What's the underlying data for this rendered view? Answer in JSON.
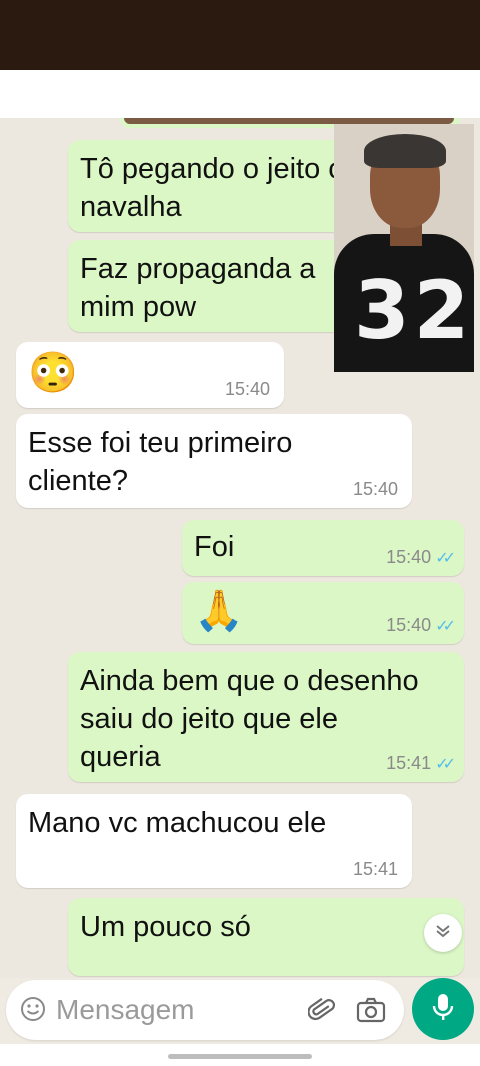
{
  "messages": [
    {
      "dir": "out",
      "text": "Tô pegando o jeito c       a\nnavalha",
      "time": ""
    },
    {
      "dir": "out",
      "text": "Faz propaganda a\nmim pow",
      "time": ""
    },
    {
      "dir": "in",
      "emoji": "😳",
      "time": "15:40"
    },
    {
      "dir": "in",
      "text": "Esse foi teu primeiro\ncliente?",
      "time": "15:40"
    },
    {
      "dir": "out",
      "text": "Foi",
      "time": "15:40"
    },
    {
      "dir": "out",
      "emoji": "🙏",
      "time": "15:40"
    },
    {
      "dir": "out",
      "text": "Ainda bem que o desenho\nsaiu do jeito que ele\nqueria",
      "time": "15:41"
    },
    {
      "dir": "in",
      "text": "Mano vc machucou ele",
      "time": "15:41"
    },
    {
      "dir": "out",
      "text": "Um pouco só",
      "time": ""
    }
  ],
  "video_overlay": {
    "shirt_number": "32"
  },
  "composer": {
    "placeholder": "Mensagem"
  },
  "icons": {
    "scroll_down": "chevron-double-down-icon",
    "emoji": "smile-icon",
    "attach": "paperclip-icon",
    "camera": "camera-icon",
    "mic": "mic-icon"
  },
  "colors": {
    "outgoing": "#dbf7c6",
    "incoming": "#ffffff",
    "accent": "#00a884",
    "tick": "#53bdeb"
  }
}
